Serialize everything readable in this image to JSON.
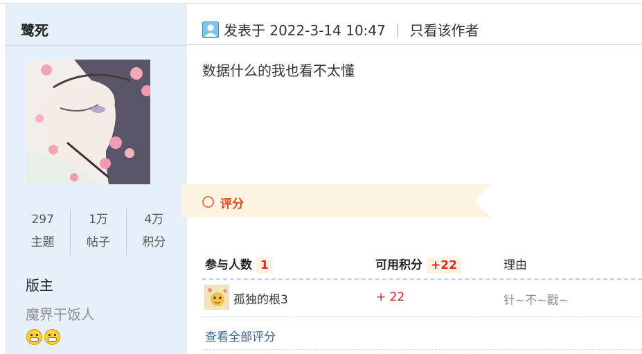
{
  "author": {
    "name": "鹭死",
    "stats": [
      {
        "value": "297",
        "label": "主题"
      },
      {
        "value": "1万",
        "label": "帖子"
      },
      {
        "value": "4万",
        "label": "积分"
      }
    ],
    "role": "版主",
    "signature": "魔界干饭人"
  },
  "post": {
    "posted_at": "发表于 2022-3-14 10:47",
    "separator": "|",
    "author_only": "只看该作者",
    "content": "数据什么的我也看不太懂"
  },
  "rating": {
    "title": "评分",
    "headers": {
      "participants_label": "参与人数",
      "participants_count": "1",
      "credits_label": "可用积分",
      "credits_total": "+22",
      "reason_label": "理由"
    },
    "rows": [
      {
        "user": "孤独的根3",
        "credit": "+ 22",
        "reason": "针~不~戳~"
      }
    ],
    "view_all": "查看全部评分"
  },
  "colors": {
    "sidebar_bg": "#e6f0fb",
    "ribbon_bg": "#fdf3e3",
    "accent_red": "#e22222",
    "link_blue": "#336699"
  }
}
